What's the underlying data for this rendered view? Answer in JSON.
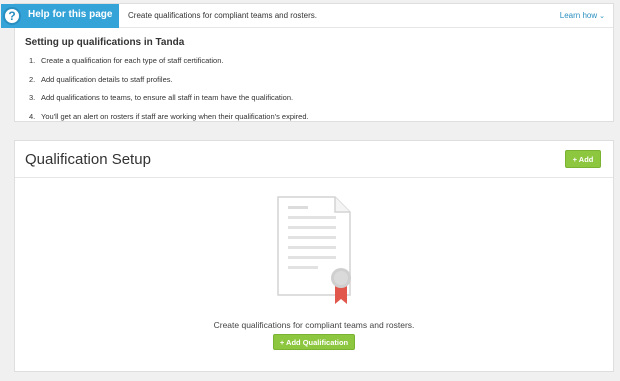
{
  "help": {
    "tab_icon": "question-icon",
    "tab_icon_glyph": "?",
    "tab_label": "Help for this page",
    "description": "Create qualifications for compliant teams and rosters.",
    "learn_how": "Learn how",
    "learn_how_icon": "chevron-down-icon",
    "title": "Setting up qualifications in Tanda",
    "steps": [
      {
        "num": "1.",
        "text": "Create a qualification for each type of staff certification."
      },
      {
        "num": "2.",
        "text": "Add qualification details to staff profiles."
      },
      {
        "num": "3.",
        "text": "Add qualifications to teams, to ensure all staff in team have the qualification."
      },
      {
        "num": "4.",
        "text": "You'll get an alert on rosters if staff are working when their qualification's expired."
      }
    ]
  },
  "setup": {
    "title": "Qualification Setup",
    "add_label": "+ Add",
    "empty_icon": "certificate-icon",
    "empty_text": "Create qualifications for compliant teams and rosters.",
    "add_qualification_label": "+ Add Qualification"
  },
  "colors": {
    "accent_blue": "#34a3d8",
    "button_green": "#8dc63f",
    "ribbon_red": "#e2574c"
  }
}
